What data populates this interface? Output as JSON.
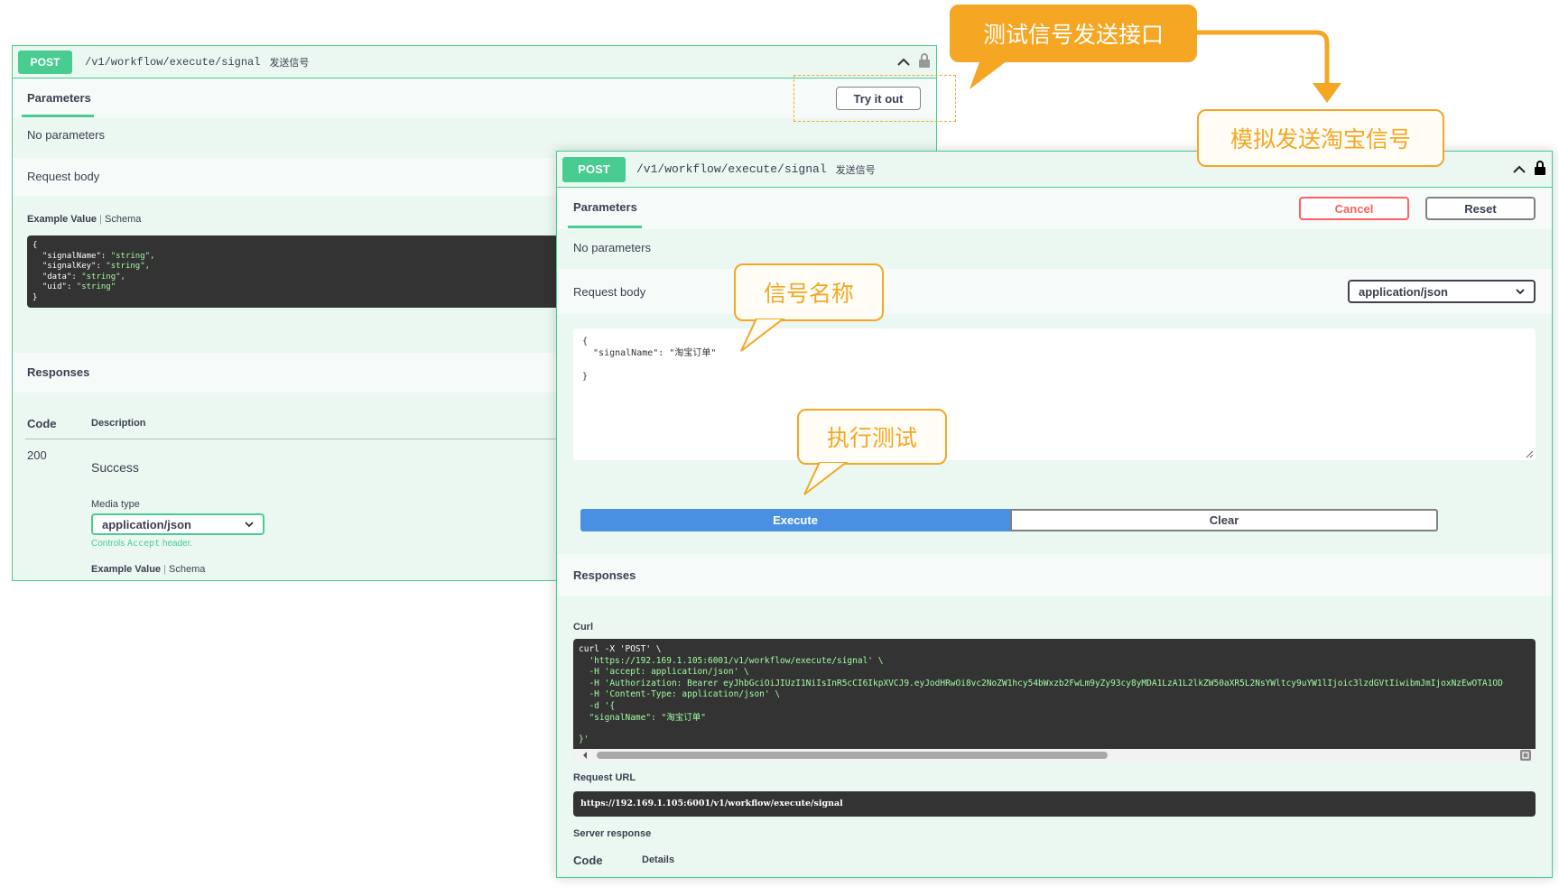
{
  "left_panel": {
    "method": "POST",
    "path": "/v1/workflow/execute/signal",
    "summary": "发送信号",
    "tab_parameters": "Parameters",
    "try_it_out": "Try it out",
    "no_parameters": "No parameters",
    "request_body": "Request body",
    "example_value": "Example Value",
    "schema": "Schema",
    "example_code": {
      "open": "{",
      "fields": [
        {
          "key": "\"signalName\"",
          "val": "\"string\","
        },
        {
          "key": "\"signalKey\"",
          "val": "\"string\","
        },
        {
          "key": "\"data\"",
          "val": "\"string\","
        },
        {
          "key": "\"uid\"",
          "val": "\"string\""
        }
      ],
      "close": "}"
    },
    "responses": "Responses",
    "col_code": "Code",
    "col_description": "Description",
    "status_code": "200",
    "status_text": "Success",
    "media_type_label": "Media type",
    "media_type_value": "application/json",
    "controls_text_pre": "Controls",
    "controls_accept": "Accept",
    "controls_text_post": "header.",
    "example_value_2": "Example Value",
    "schema_2": "Schema"
  },
  "right_panel": {
    "method": "POST",
    "path": "/v1/workflow/execute/signal",
    "summary": "发送信号",
    "tab_parameters": "Parameters",
    "cancel": "Cancel",
    "reset": "Reset",
    "no_parameters": "No parameters",
    "request_body": "Request body",
    "content_type": "application/json",
    "body_lines": [
      "{",
      "  \"signalName\": \"淘宝订单\"",
      "",
      "}"
    ],
    "execute": "Execute",
    "clear": "Clear",
    "responses": "Responses",
    "curl_label": "Curl",
    "curl_lines": [
      "curl -X 'POST' \\",
      "  'https://192.169.1.105:6001/v1/workflow/execute/signal' \\",
      "  -H 'accept: application/json' \\",
      "  -H 'Authorization: Bearer eyJhbGciOiJIUzI1NiIsInR5cCI6IkpXVCJ9.eyJodHRwOi8vc2NoZW1hcy54bWxzb2FwLm9yZy93cy8yMDA1LzA1L2lkZW50aXR5L2NsYWltcy9uYW1lIjoic3lzdGVtIiwibmJmIjoxNzEwOTA1OD",
      "  -H 'Content-Type: application/json' \\",
      "  -d '{",
      "  \"signalName\": \"淘宝订单\"",
      "",
      "}'"
    ],
    "request_url_label": "Request URL",
    "request_url": "https://192.169.1.105:6001/v1/workflow/execute/signal",
    "server_response": "Server response",
    "col_code": "Code",
    "col_details": "Details"
  },
  "callouts": {
    "test_interface": "测试信号发送接口",
    "simulate": "模拟发送淘宝信号",
    "signal_name": "信号名称",
    "execute_test": "执行测试"
  },
  "colors": {
    "post_green": "#49cc90",
    "panel_bg": "#ebf7f1",
    "execute_blue": "#4990e2",
    "cancel_red": "#ff6060",
    "callout_orange": "#f5a623"
  }
}
